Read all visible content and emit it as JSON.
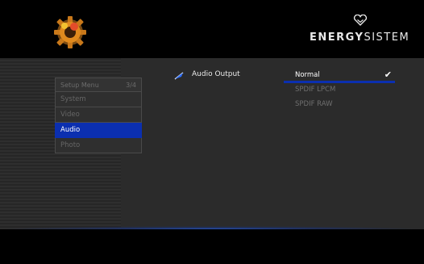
{
  "brand": {
    "name_bold": "ENERGY",
    "name_rest": "SISTEM"
  },
  "menu": {
    "title": "Setup Menu",
    "page": "3/4",
    "items": [
      {
        "label": "System",
        "active": false
      },
      {
        "label": "Video",
        "active": false
      },
      {
        "label": "Audio",
        "active": true
      },
      {
        "label": "Photo",
        "active": false
      }
    ]
  },
  "option": {
    "label": "Audio Output"
  },
  "values": [
    {
      "label": "Normal",
      "selected": true
    },
    {
      "label": "SPDIF LPCM",
      "selected": false
    },
    {
      "label": "SPDIF RAW",
      "selected": false
    }
  ],
  "colors": {
    "accent": "#0b2fb0",
    "background": "#2b2b2b"
  }
}
